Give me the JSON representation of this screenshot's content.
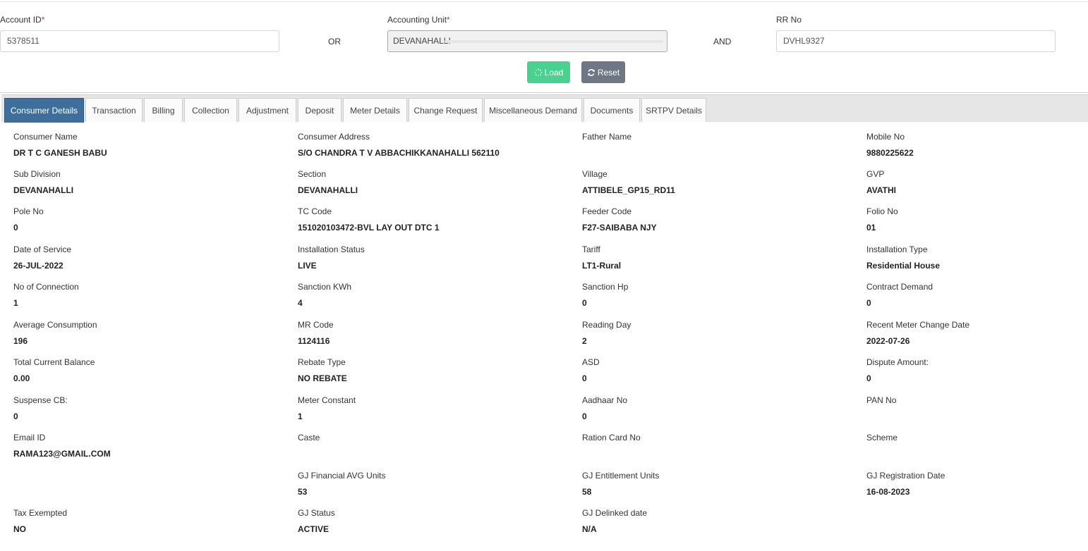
{
  "search": {
    "account_id_label": "Account ID",
    "account_id_required": "*",
    "account_id_value": "5378511",
    "or_text": "OR",
    "accounting_unit_label": "Accounting Unit",
    "accounting_unit_required": "*",
    "accounting_unit_value": "DEVANAHALLI",
    "and_text": "AND",
    "rr_no_label": "RR No",
    "rr_no_value": "DVHL9327",
    "load_label": "Load",
    "reset_label": "Reset"
  },
  "colors": {
    "load_button": "#49d18f",
    "reset_button": "#6f7684",
    "active_tab": "#3e6f9c",
    "required": "#e3342f"
  },
  "tabs": [
    {
      "label": "Consumer Details",
      "active": true
    },
    {
      "label": "Transaction"
    },
    {
      "label": "Billing"
    },
    {
      "label": "Collection"
    },
    {
      "label": "Adjustment"
    },
    {
      "label": "Deposit"
    },
    {
      "label": "Meter Details"
    },
    {
      "label": "Change Request"
    },
    {
      "label": "Miscellaneous Demand"
    },
    {
      "label": "Documents"
    },
    {
      "label": "SRTPV Details"
    }
  ],
  "details": {
    "consumer_name": {
      "label": "Consumer Name",
      "value": "DR T C GANESH BABU"
    },
    "consumer_address": {
      "label": "Consumer Address",
      "value": "S/O CHANDRA T V ABBACHIKKANAHALLI 562110"
    },
    "father_name": {
      "label": "Father Name",
      "value": ""
    },
    "mobile_no": {
      "label": "Mobile No",
      "value": "9880225622"
    },
    "sub_division": {
      "label": "Sub Division",
      "value": "DEVANAHALLI"
    },
    "section": {
      "label": "Section",
      "value": "DEVANAHALLI"
    },
    "village": {
      "label": "Village",
      "value": "ATTIBELE_GP15_RD11"
    },
    "gvp": {
      "label": "GVP",
      "value": "AVATHI"
    },
    "pole_no": {
      "label": "Pole No",
      "value": "0"
    },
    "tc_code": {
      "label": "TC Code",
      "value": "151020103472-BVL LAY OUT DTC 1"
    },
    "feeder_code": {
      "label": "Feeder Code",
      "value": "F27-SAIBABA NJY"
    },
    "folio_no": {
      "label": "Folio No",
      "value": "01"
    },
    "date_of_service": {
      "label": "Date of Service",
      "value": "26-JUL-2022"
    },
    "installation_status": {
      "label": "Installation Status",
      "value": "LIVE"
    },
    "tariff": {
      "label": "Tariff",
      "value": "LT1-Rural"
    },
    "installation_type": {
      "label": "Installation Type",
      "value": "Residential House"
    },
    "no_of_connection": {
      "label": "No of Connection",
      "value": "1"
    },
    "sanction_kwh": {
      "label": "Sanction KWh",
      "value": "4"
    },
    "sanction_hp": {
      "label": "Sanction Hp",
      "value": "0"
    },
    "contract_demand": {
      "label": "Contract Demand",
      "value": "0"
    },
    "average_consumption": {
      "label": "Average Consumption",
      "value": "196"
    },
    "mr_code": {
      "label": "MR Code",
      "value": "1124116"
    },
    "reading_day": {
      "label": "Reading Day",
      "value": "2"
    },
    "recent_meter_change_date": {
      "label": "Recent Meter Change Date",
      "value": "2022-07-26"
    },
    "total_current_balance": {
      "label": "Total Current Balance",
      "value": "0.00"
    },
    "rebate_type": {
      "label": "Rebate Type",
      "value": "NO REBATE"
    },
    "asd": {
      "label": "ASD",
      "value": "0"
    },
    "dispute_amount": {
      "label": "Dispute Amount:",
      "value": "0"
    },
    "suspense_cb": {
      "label": "Suspense CB:",
      "value": "0"
    },
    "meter_constant": {
      "label": "Meter Constant",
      "value": "1"
    },
    "aadhaar_no": {
      "label": "Aadhaar No",
      "value": "0"
    },
    "pan_no": {
      "label": "PAN No",
      "value": ""
    },
    "email_id": {
      "label": "Email ID",
      "value": "RAMA123@GMAIL.COM"
    },
    "caste": {
      "label": "Caste",
      "value": ""
    },
    "ration_card_no": {
      "label": "Ration Card No",
      "value": ""
    },
    "scheme": {
      "label": "Scheme",
      "value": ""
    },
    "gj_financial_avg_units": {
      "label": "GJ Financial AVG Units",
      "value": "53"
    },
    "gj_entitlement_units": {
      "label": "GJ Entitlement Units",
      "value": "58"
    },
    "gj_registration_date": {
      "label": "GJ Registration Date",
      "value": "16-08-2023"
    },
    "tax_exempted": {
      "label": "Tax Exempted",
      "value": "NO"
    },
    "gj_status": {
      "label": "GJ Status",
      "value": "ACTIVE"
    },
    "gj_delinked_date": {
      "label": "GJ Delinked date",
      "value": "N/A"
    }
  }
}
